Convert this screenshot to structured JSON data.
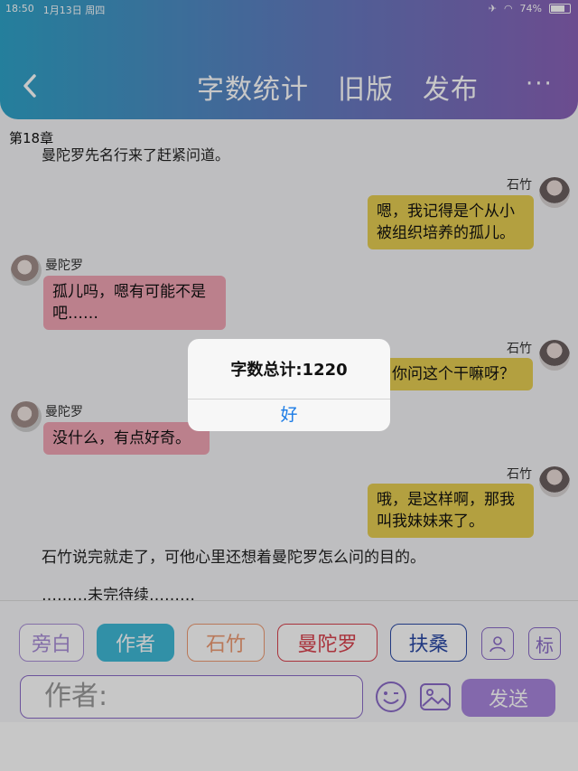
{
  "status": {
    "time": "18:50",
    "date": "1月13日 周四",
    "battery": "74%"
  },
  "header": {
    "word_count_label": "字数统计",
    "old_version_label": "旧版",
    "publish_label": "发布",
    "more_label": "···"
  },
  "chapter": "第18章",
  "chat": {
    "cut_line": "曼陀罗先名行来了赶紧问道。",
    "messages": [
      {
        "speaker": "石竹",
        "side": "right",
        "color": "yellow",
        "lines": [
          "嗯，我记得是个从小",
          "被组织培养的孤儿。"
        ]
      },
      {
        "speaker": "曼陀罗",
        "side": "left",
        "color": "pink",
        "lines": [
          "孤儿吗，嗯有可能不是",
          "吧……"
        ]
      },
      {
        "speaker": "石竹",
        "side": "right",
        "color": "yellow",
        "lines": [
          "你问这个干嘛呀？"
        ]
      },
      {
        "speaker": "曼陀罗",
        "side": "left",
        "color": "pink",
        "lines": [
          "没什么，有点好奇。"
        ]
      },
      {
        "speaker": "石竹",
        "side": "right",
        "color": "yellow",
        "lines": [
          "哦，是这样啊，那我",
          "叫我妹妹来了。"
        ]
      }
    ],
    "narration": "石竹说完就走了，可他心里还想着曼陀罗怎么问的目的。",
    "tbc": "………未完待续………"
  },
  "roles": [
    {
      "label": "旁白",
      "color": "#a98fd8",
      "active": false
    },
    {
      "label": "作者",
      "color": "#3fb9d6",
      "active": true
    },
    {
      "label": "石竹",
      "color": "#ee9a72",
      "active": false
    },
    {
      "label": "曼陀罗",
      "color": "#d9424e",
      "active": false
    },
    {
      "label": "扶桑",
      "color": "#2b4aa6",
      "active": false
    }
  ],
  "tools": {
    "character_icon": "person-card-icon",
    "tag_label": "标"
  },
  "input": {
    "placeholder": "作者:"
  },
  "send_label": "发送",
  "dialog": {
    "title": "字数总计:1220",
    "ok_label": "好"
  }
}
